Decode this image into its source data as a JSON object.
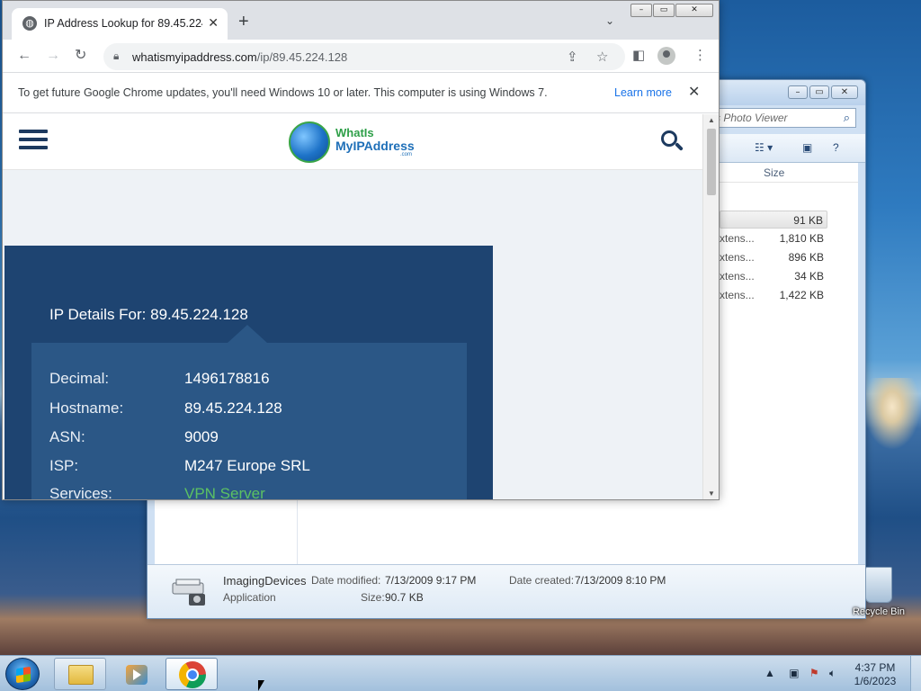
{
  "explorer": {
    "search_placeholder": "s Photo Viewer",
    "column_size": "Size",
    "files": [
      {
        "type": "",
        "size": "91 KB"
      },
      {
        "type": "xtens...",
        "size": "1,810 KB"
      },
      {
        "type": "xtens...",
        "size": "896 KB"
      },
      {
        "type": "xtens...",
        "size": "34 KB"
      },
      {
        "type": "xtens...",
        "size": "1,422 KB"
      }
    ],
    "details": {
      "name": "ImagingDevices",
      "kind": "Application",
      "modified_label": "Date modified:",
      "modified_value": "7/13/2009 9:17 PM",
      "created_label": "Date created:",
      "created_value": "7/13/2009 8:10 PM",
      "size_label": "Size:",
      "size_value": "90.7 KB"
    }
  },
  "chrome": {
    "tab_title": "IP Address Lookup for 89.45.224.128",
    "url_host": "whatismyipaddress.com",
    "url_path": "/ip/89.45.224.128",
    "infobar_message": "To get future Google Chrome updates, you'll need Windows 10 or later. This computer is using Windows 7.",
    "infobar_link": "Learn more"
  },
  "site": {
    "logo_line1": "WhatIs",
    "logo_line2": "MyIPAddress",
    "logo_line3": ".com",
    "details_title": "IP Details For: 89.45.224.128",
    "rows": [
      {
        "key": "Decimal:",
        "value": "1496178816"
      },
      {
        "key": "Hostname:",
        "value": "89.45.224.128"
      },
      {
        "key": "ASN:",
        "value": "9009"
      },
      {
        "key": "ISP:",
        "value": "M247 Europe SRL"
      },
      {
        "key": "Services:",
        "value": "VPN Server"
      }
    ]
  },
  "desktop": {
    "recycle_bin": "Recycle Bin"
  },
  "taskbar": {
    "time": "4:37 PM",
    "date": "1/6/2023"
  }
}
